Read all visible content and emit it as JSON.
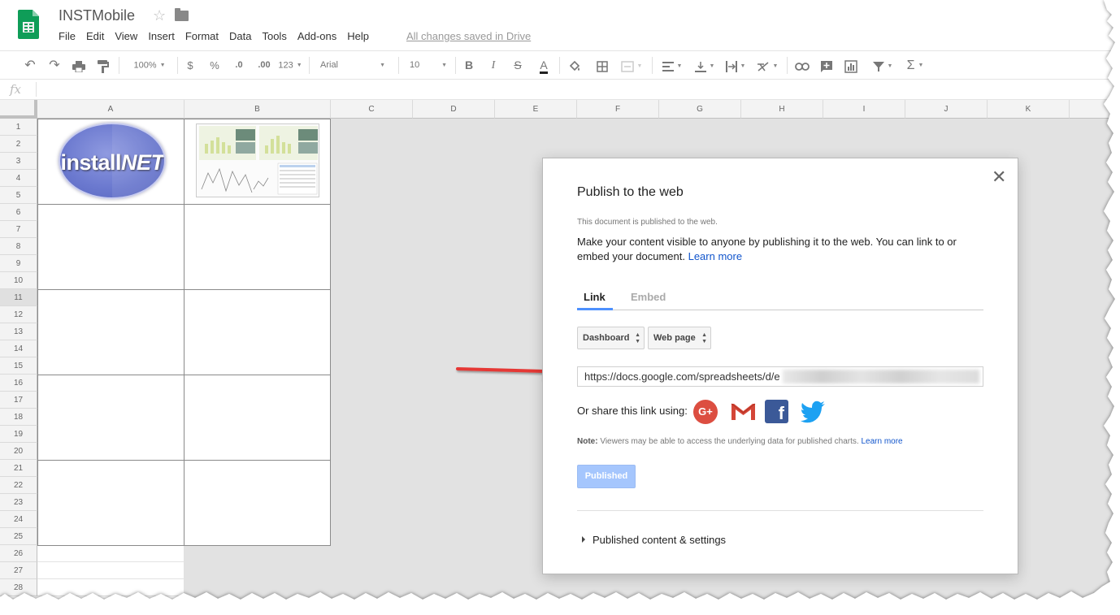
{
  "app": {
    "doc_title": "INSTMobile",
    "save_status": "All changes saved in Drive",
    "menu": [
      "File",
      "Edit",
      "View",
      "Insert",
      "Format",
      "Data",
      "Tools",
      "Add-ons",
      "Help"
    ]
  },
  "toolbar": {
    "zoom": "100%",
    "currency": "$",
    "percent": "%",
    "decrease_decimals": ".0",
    "increase_decimals": ".00",
    "more_formats": "123",
    "font": "Arial",
    "font_size": "10",
    "bold": "B",
    "italic": "I",
    "strikethrough": "S",
    "text_color": "A",
    "sum": "Σ"
  },
  "formula_bar": {
    "fx": "fx"
  },
  "grid": {
    "columns": [
      "A",
      "B",
      "C",
      "D",
      "E",
      "F",
      "G",
      "H",
      "I",
      "J",
      "K"
    ],
    "rows": [
      "1",
      "2",
      "3",
      "4",
      "5",
      "6",
      "7",
      "8",
      "9",
      "10",
      "11",
      "12",
      "13",
      "14",
      "15",
      "16",
      "17",
      "18",
      "19",
      "20",
      "21",
      "22",
      "23",
      "24",
      "25",
      "26",
      "27",
      "28"
    ],
    "selected_row": "11",
    "logo_text_a": "install",
    "logo_text_b": "NET"
  },
  "dialog": {
    "title": "Publish to the web",
    "status": "This document is published to the web.",
    "description": "Make your content visible to anyone by publishing it to the web. You can link to or embed your document.",
    "learn_more": "Learn more",
    "tabs": {
      "link": "Link",
      "embed": "Embed"
    },
    "sheet_select": "Dashboard",
    "format_select": "Web page",
    "url": "https://docs.google.com/spreadsheets/d/e",
    "share_label": "Or share this link using:",
    "gplus_label": "G+",
    "facebook_label": "f",
    "note_label": "Note:",
    "note_text": "Viewers may be able to access the underlying data for published charts.",
    "note_learn_more": "Learn more",
    "published_button": "Published",
    "settings_toggle": "Published content & settings"
  },
  "colors": {
    "accent_blue": "#4d90fe",
    "sheets_green": "#0f9d58",
    "link_blue": "#1155cc",
    "arrow_red": "#e53935"
  }
}
